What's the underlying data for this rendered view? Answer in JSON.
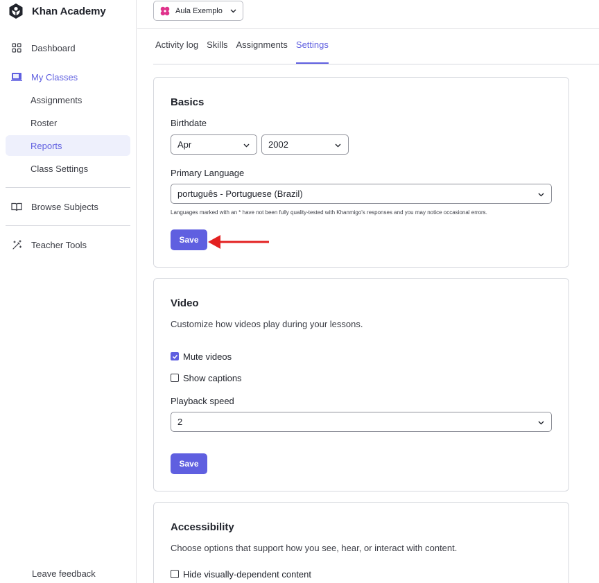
{
  "brand": {
    "name": "Khan Academy"
  },
  "sidebar": {
    "items": [
      {
        "label": "Dashboard",
        "icon": "grid-icon"
      },
      {
        "label": "My Classes",
        "icon": "classroom-icon"
      },
      {
        "label": "Browse Subjects",
        "icon": "book-icon"
      },
      {
        "label": "Teacher Tools",
        "icon": "magic-wand-icon"
      }
    ],
    "subitems": [
      {
        "label": "Assignments"
      },
      {
        "label": "Roster"
      },
      {
        "label": "Reports"
      },
      {
        "label": "Class Settings"
      }
    ],
    "leave_feedback": "Leave feedback"
  },
  "class_selector": {
    "value": "Aula Exemplo"
  },
  "tabs": [
    {
      "label": "Activity log"
    },
    {
      "label": "Skills"
    },
    {
      "label": "Assignments"
    },
    {
      "label": "Settings"
    }
  ],
  "basics": {
    "title": "Basics",
    "birthdate_label": "Birthdate",
    "month": "Apr",
    "year": "2002",
    "language_label": "Primary Language",
    "language": "português - Portuguese (Brazil)",
    "language_note": "Languages marked with an * have not been fully quality-tested with Khanmigo's responses and you may notice occasional errors.",
    "save_label": "Save"
  },
  "video": {
    "title": "Video",
    "description": "Customize how videos play during your lessons.",
    "mute_label": "Mute videos",
    "mute_checked": true,
    "captions_label": "Show captions",
    "captions_checked": false,
    "speed_label": "Playback speed",
    "speed": "2",
    "save_label": "Save"
  },
  "accessibility": {
    "title": "Accessibility",
    "description": "Choose options that support how you see, hear, or interact with content.",
    "hide_label": "Hide visually-dependent content",
    "hide_checked": false
  },
  "colors": {
    "accent": "#5f5fe0",
    "annotation_arrow": "#e32121"
  }
}
